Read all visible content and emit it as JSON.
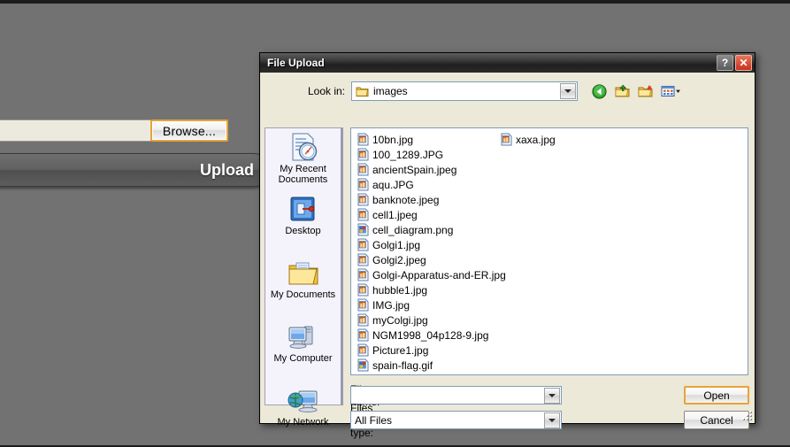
{
  "background": {
    "file_input": {
      "value": "",
      "name": "file-input"
    },
    "browse_button": {
      "label": "Browse..."
    },
    "upload_button": {
      "label": "Upload"
    }
  },
  "dialog": {
    "title": "File Upload",
    "titlebar_buttons": [
      {
        "name": "help-button",
        "glyph": "?"
      },
      {
        "name": "close-button",
        "glyph": "✕"
      }
    ],
    "lookin": {
      "label": "Look in:",
      "value": "images",
      "icon": "folder-icon"
    },
    "toolbar": [
      {
        "name": "back-icon",
        "tip": "Back"
      },
      {
        "name": "up-folder-icon",
        "tip": "Up One Level"
      },
      {
        "name": "new-folder-icon",
        "tip": "Create New Folder"
      },
      {
        "name": "views-icon",
        "tip": "Views"
      }
    ],
    "places": [
      {
        "label": "My Recent Documents",
        "icon": "recent-documents-icon"
      },
      {
        "label": "Desktop",
        "icon": "desktop-icon"
      },
      {
        "label": "My Documents",
        "icon": "my-documents-icon"
      },
      {
        "label": "My Computer",
        "icon": "my-computer-icon"
      },
      {
        "label": "My Network",
        "icon": "my-network-icon"
      }
    ],
    "files": [
      {
        "name": "10bn.jpg",
        "icon": "jpeg-file-icon"
      },
      {
        "name": "100_1289.JPG",
        "icon": "jpeg-file-icon"
      },
      {
        "name": "ancientSpain.jpeg",
        "icon": "jpeg-file-icon"
      },
      {
        "name": "aqu.JPG",
        "icon": "jpeg-file-icon"
      },
      {
        "name": "banknote.jpeg",
        "icon": "jpeg-file-icon"
      },
      {
        "name": "cell1.jpeg",
        "icon": "jpeg-file-icon"
      },
      {
        "name": "cell_diagram.png",
        "icon": "image-file-icon"
      },
      {
        "name": "Golgi1.jpg",
        "icon": "jpeg-file-icon"
      },
      {
        "name": "Golgi2.jpeg",
        "icon": "jpeg-file-icon"
      },
      {
        "name": "Golgi-Apparatus-and-ER.jpg",
        "icon": "jpeg-file-icon"
      },
      {
        "name": "hubble1.jpg",
        "icon": "jpeg-file-icon"
      },
      {
        "name": "IMG.jpg",
        "icon": "jpeg-file-icon"
      },
      {
        "name": "myColgi.jpg",
        "icon": "jpeg-file-icon"
      },
      {
        "name": "NGM1998_04p128-9.jpg",
        "icon": "jpeg-file-icon"
      },
      {
        "name": "Picture1.jpg",
        "icon": "jpeg-file-icon"
      },
      {
        "name": "spain-flag.gif",
        "icon": "image-file-icon"
      },
      {
        "name": "xaxa.jpg",
        "icon": "jpeg-file-icon"
      }
    ],
    "filename_field": {
      "label": "File name:",
      "value": ""
    },
    "filetype_field": {
      "label": "Files of type:",
      "value": "All Files"
    },
    "open_button": {
      "label": "Open"
    },
    "cancel_button": {
      "label": "Cancel"
    }
  },
  "colors": {
    "page_background": "#727272",
    "dialog_face": "#ece9d8",
    "places_bar": "#f4f3fb",
    "focus_border": "#e7a33a",
    "close_button": "#c5331c"
  }
}
